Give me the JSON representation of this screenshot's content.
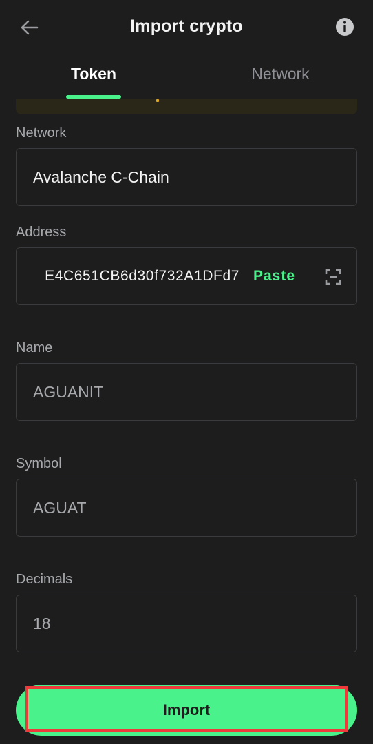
{
  "header": {
    "title": "Import crypto",
    "back_icon": "arrow-left-icon",
    "info_icon": "info-circle-icon"
  },
  "tabs": [
    {
      "label": "Token",
      "active": true
    },
    {
      "label": "Network",
      "active": false
    }
  ],
  "form": {
    "network": {
      "label": "Network",
      "value": "Avalanche C-Chain"
    },
    "address": {
      "label": "Address",
      "value": "0x...E4C651CB6d30f732A1DFd7",
      "visible_value": "E4C651CB6d30f732A1DFd7",
      "paste_label": "Paste",
      "scan_icon": "scan-icon"
    },
    "name": {
      "label": "Name",
      "placeholder": "AGUANIT"
    },
    "symbol": {
      "label": "Symbol",
      "placeholder": "AGUAT"
    },
    "decimals": {
      "label": "Decimals",
      "value": "18"
    }
  },
  "actions": {
    "import_label": "Import"
  },
  "colors": {
    "background": "#1d1d1d",
    "accent": "#49f28a",
    "border": "#3a3b3e",
    "muted_text": "#a7a9ad",
    "highlight": "#ee3a3a"
  }
}
